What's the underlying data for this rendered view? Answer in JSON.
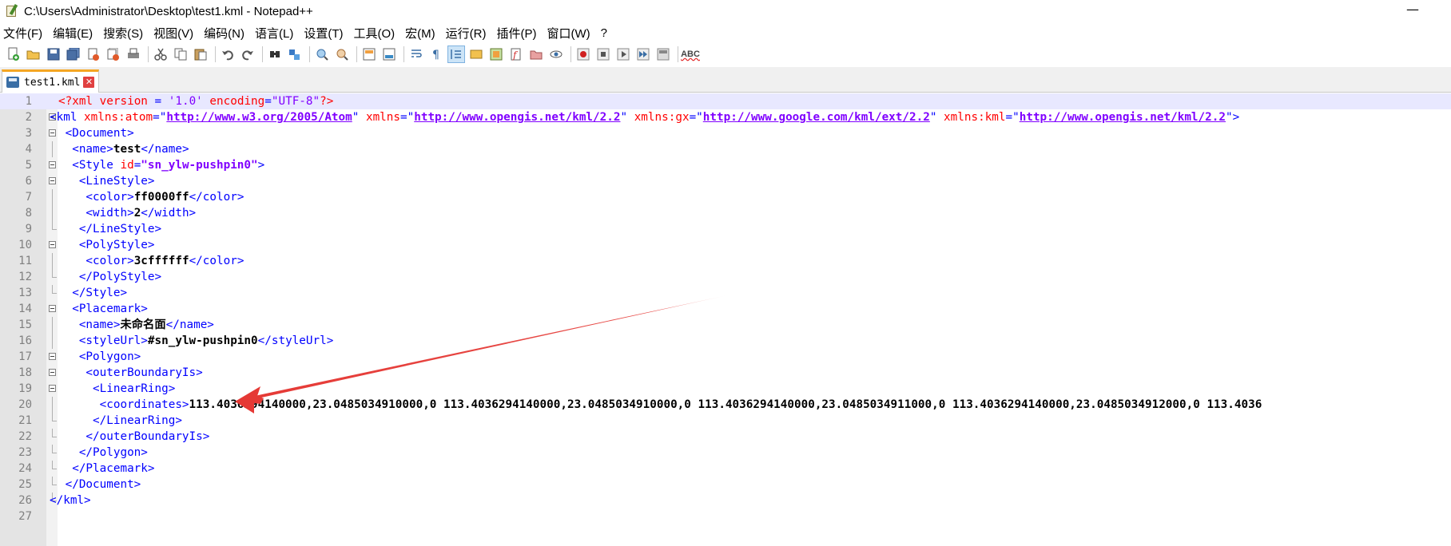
{
  "window": {
    "title": "C:\\Users\\Administrator\\Desktop\\test1.kml - Notepad++",
    "minimize": "—"
  },
  "menu": [
    "文件(F)",
    "编辑(E)",
    "搜索(S)",
    "视图(V)",
    "编码(N)",
    "语言(L)",
    "设置(T)",
    "工具(O)",
    "宏(M)",
    "运行(R)",
    "插件(P)",
    "窗口(W)",
    "?"
  ],
  "toolbar": {
    "spellcheck_label": "ABC",
    "icons": [
      "new-file-icon",
      "open-file-icon",
      "save-icon",
      "save-all-icon",
      "close-icon",
      "close-all-icon",
      "print-icon",
      "cut-icon",
      "copy-icon",
      "paste-icon",
      "undo-icon",
      "redo-icon",
      "find-icon",
      "replace-icon",
      "zoom-in-icon",
      "zoom-out-icon",
      "sync-vertical-icon",
      "sync-horizontal-icon",
      "word-wrap-icon",
      "show-all-chars-icon",
      "indent-guide-icon",
      "udl-icon",
      "doc-map-icon",
      "function-list-icon",
      "folder-workspace-icon",
      "monitor-icon",
      "record-macro-icon",
      "stop-macro-icon",
      "play-macro-icon",
      "run-macro-multiple-icon",
      "save-macro-icon",
      "spellcheck-icon"
    ]
  },
  "tab": {
    "label": "test1.kml",
    "close": "✕"
  },
  "editor": {
    "current_line": 1,
    "line_numbers": [
      "1",
      "2",
      "3",
      "4",
      "5",
      "6",
      "7",
      "8",
      "9",
      "10",
      "11",
      "12",
      "13",
      "14",
      "15",
      "16",
      "17",
      "18",
      "19",
      "20",
      "21",
      "22",
      "23",
      "24",
      "25",
      "26",
      "27"
    ],
    "text": {
      "l1_open": "<?xml ",
      "l1_attr1": "version",
      "l1_eq1": " = ",
      "l1_val1": "'1.0'",
      "l1_attr2": " encoding",
      "l1_eq2": "=",
      "l1_val2": "\"UTF-8\"",
      "l1_close": "?>",
      "l2_open": "<kml ",
      "l2_a1": "xmlns:atom",
      "l2_v1": "http://www.w3.org/2005/Atom",
      "l2_a2": "xmlns",
      "l2_v2": "http://www.opengis.net/kml/2.2",
      "l2_a3": "xmlns:gx",
      "l2_v3": "http://www.google.com/kml/ext/2.2",
      "l2_a4": "xmlns:kml",
      "l2_v4": "http://www.opengis.net/kml/2.2",
      "l3": " <Document>",
      "l4_open": "  <name>",
      "l4_text": "test",
      "l4_close": "</name>",
      "l5_open": "  <Style ",
      "l5_attr": "id",
      "l5_val": "\"sn_ylw-pushpin0\"",
      "l5_close": ">",
      "l6": "   <LineStyle>",
      "l7_open": "    <color>",
      "l7_text": "ff0000ff",
      "l7_close": "</color>",
      "l8_open": "    <width>",
      "l8_text": "2",
      "l8_close": "</width>",
      "l9": "   </LineStyle>",
      "l10": "   <PolyStyle>",
      "l11_open": "    <color>",
      "l11_text": "3cffffff",
      "l11_close": "</color>",
      "l12": "   </PolyStyle>",
      "l13": "  </Style>",
      "l14": "  <Placemark>",
      "l15_open": "   <name>",
      "l15_text": "未命名面",
      "l15_close": "</name>",
      "l16_open": "   <styleUrl>",
      "l16_text": "#sn_ylw-pushpin0",
      "l16_close": "</styleUrl>",
      "l17": "   <Polygon>",
      "l18": "    <outerBoundaryIs>",
      "l19": "     <LinearRing>",
      "l20_open": "      <coordinates>",
      "l20_text": "113.4036294140000,23.0485034910000,0 113.4036294140000,23.0485034910000,0 113.4036294140000,23.0485034911000,0 113.4036294140000,23.0485034912000,0 113.4036",
      "l21": "     </LinearRing>",
      "l22": "    </outerBoundaryIs>",
      "l23": "   </Polygon>",
      "l24": "  </Placemark>",
      "l25": " </Document>",
      "l26": "</kml>"
    }
  },
  "colors": {
    "tag": "#0000ff",
    "attribute": "#ff0000",
    "value": "#8000ff",
    "annotation_arrow": "#e53935",
    "tab_accent": "#f5a623"
  }
}
